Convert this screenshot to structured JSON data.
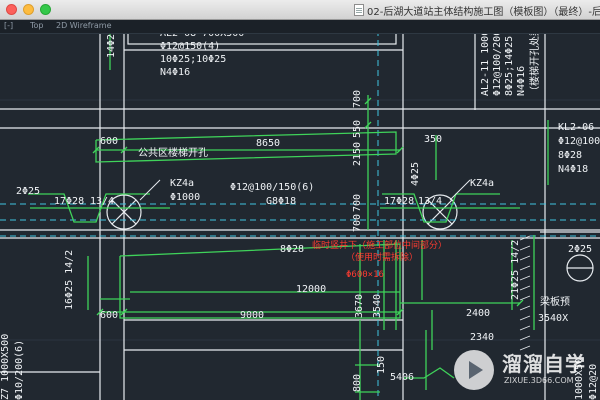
{
  "window": {
    "title": "02-后湖大道站主体结构施工图（模板图）（最终）-后湖"
  },
  "viewport": {
    "control": "[-]",
    "view": "Top",
    "style": "2D Wireframe"
  },
  "drawing": {
    "top_left_labels": [
      "AL2-08 700X500",
      "Φ12@150(4)",
      "10Φ25;10Φ25",
      "N4Φ16"
    ],
    "top_left_vertical": "14Φ25",
    "top_right_vertical": [
      "AL2-11 1000",
      "Φ12@100/200",
      "8Φ25;14Φ25",
      "N4Φ16",
      "（楼梯开孔处梁）"
    ],
    "right_labels": [
      "KL2-06",
      "Φ12@100",
      "8Φ28",
      "N4Φ18"
    ],
    "opening_label": "公共区楼梯开孔",
    "dims_row1": {
      "left_600": "600",
      "span_8650": "8650",
      "right_350": "350"
    },
    "left_2phi25": "2Φ25",
    "kz4a_left": [
      "KZ4a",
      "Φ1000"
    ],
    "kz4a_right": "KZ4a",
    "center_rebar": [
      "Φ12@100/150(6)",
      "G8Φ18"
    ],
    "bar_left": [
      "17Φ28",
      "13/4"
    ],
    "bar_right": [
      "17Φ28",
      "13/4"
    ],
    "right_2phi25": "2Φ25",
    "vertical_dims": [
      "700",
      "550",
      "2150",
      "700",
      "700"
    ],
    "mid_vertical": "4Φ25",
    "lower_8phi28": "8Φ28",
    "red_note": [
      "临时竖井下（施工部位中间部分）",
      "（使用时需拆除）"
    ],
    "red_pipe": "Φ600×16",
    "dim_12000": "12000",
    "dim_3540": "3540",
    "dim_3670": "3670",
    "dims_row2": {
      "left_600": "600",
      "span_9000": "9000",
      "right_2400": "2400"
    },
    "right_vertical_label": "21Φ25 14/2",
    "left_vertical_label": "16Φ25 14/2",
    "beam_note": "梁板预",
    "beam_dim": "3540X",
    "bottom_dims": [
      "800",
      "150",
      "5406"
    ],
    "bottom_left_labels": [
      "Z7 1000X500",
      "Φ10/200(6)"
    ],
    "bottom_right_labels": [
      "1000X50",
      "Φ12@20"
    ],
    "cut_off": "2340"
  },
  "watermark": {
    "brand": "溜溜自学",
    "url": "ZIXUE.3D66.COM"
  },
  "colors": {
    "background": "#212830",
    "green": "#3fd35a",
    "white": "#f0f3f6",
    "cyan": "#3ec3e0",
    "red": "#ff3b30"
  }
}
